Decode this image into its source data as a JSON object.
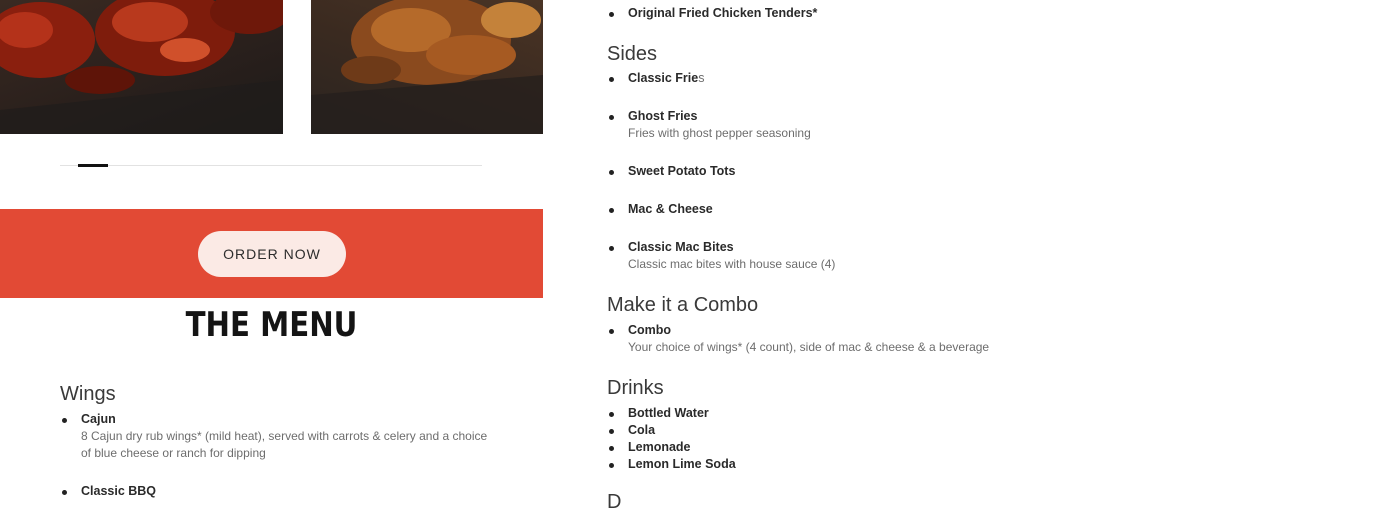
{
  "order": {
    "label": "ORDER NOW"
  },
  "menu": {
    "title": "THE MENU"
  },
  "wings": {
    "heading": "Wings",
    "items": [
      {
        "name": "Cajun",
        "desc": "8 Cajun dry rub wings* (mild heat), served with carrots & celery and a choice of blue cheese or ranch for dipping"
      },
      {
        "name": "Classic BBQ"
      }
    ]
  },
  "tenders": {
    "items": [
      {
        "name": "Original Fried Chicken Tenders*"
      }
    ]
  },
  "sides": {
    "heading": "Sides",
    "items": [
      {
        "name": "Classic Frie",
        "name_tail": "s"
      },
      {
        "name": "Ghost Fries",
        "desc": "Fries with ghost pepper seasoning"
      },
      {
        "name": "Sweet Potato Tots"
      },
      {
        "name": "Mac & Cheese"
      },
      {
        "name": "Classic Mac Bites",
        "desc": "Classic mac bites with house sauce (4)"
      }
    ]
  },
  "combo": {
    "heading": "Make it a Combo",
    "items": [
      {
        "name": "Combo",
        "desc": "Your choice of wings* (4 count), side of mac & cheese & a beverage"
      }
    ]
  },
  "drinks": {
    "heading": "Drinks",
    "items": [
      {
        "name": "Bottled Water"
      },
      {
        "name": "Cola"
      },
      {
        "name": "Lemonade"
      },
      {
        "name": "Lemon Lime Soda"
      }
    ]
  },
  "next_section": {
    "heading": "D"
  },
  "colors": {
    "accent": "#e24a35",
    "button_bg": "#fbeae5"
  }
}
